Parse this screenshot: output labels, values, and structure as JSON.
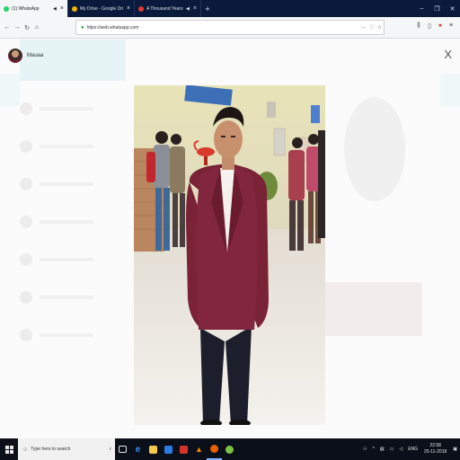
{
  "browser": {
    "tabs": [
      {
        "label": "(1) WhatsApp",
        "active": true,
        "favicon_color": "#25d366"
      },
      {
        "label": "My Drive - Google Drive",
        "active": false,
        "favicon_color": "#f4b400"
      },
      {
        "label": "A Thousand Years - Christi...",
        "active": false,
        "favicon_color": "#e53935"
      }
    ],
    "url": "https://web.whatsapp.com",
    "url_actions": [
      "...",
      "♡",
      "☆"
    ]
  },
  "viewer": {
    "contact_name": "Mauaa",
    "close_glyph": "X"
  },
  "taskbar": {
    "search_placeholder": "Type here to search",
    "tray_lang": "ENG",
    "time": "22:58",
    "date": "25-11-2018"
  },
  "colors": {
    "accent_whatsapp": "#25d366",
    "tabbar_bg": "#0a1a3c",
    "taskbar_bg": "#0b0f1a"
  }
}
